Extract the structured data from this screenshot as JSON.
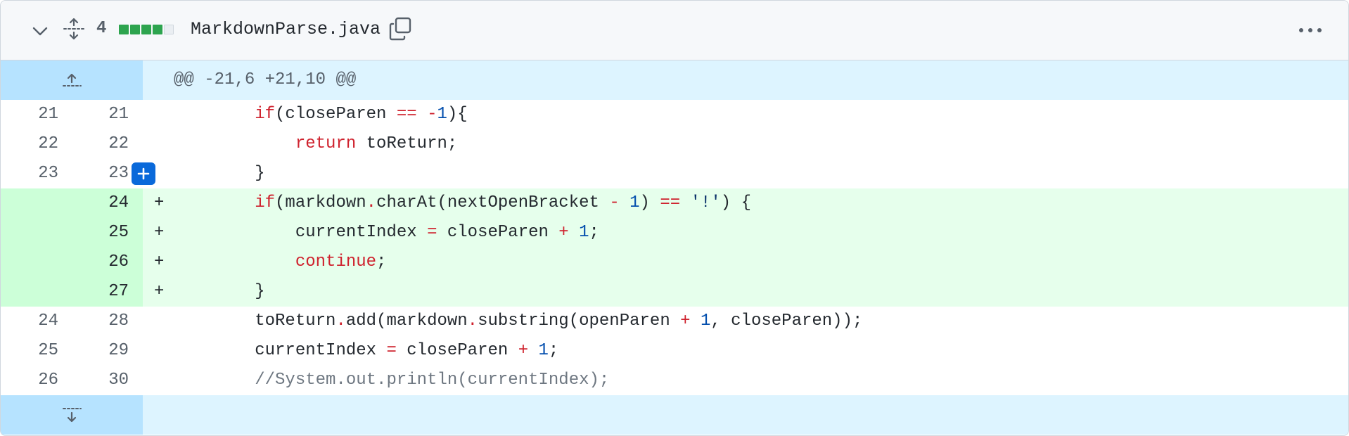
{
  "file": {
    "changes_count": "4",
    "diffstat_blocks": [
      "added",
      "added",
      "added",
      "added",
      "neutral"
    ],
    "filename": "MarkdownParse.java",
    "hunk_header": "@@ -21,6 +21,10 @@"
  },
  "lines": [
    {
      "old": "21",
      "new": "21",
      "type": "context",
      "marker": "",
      "tokens": [
        [
          "plain",
          "        "
        ],
        [
          "k",
          "if"
        ],
        [
          "plain",
          "(closeParen "
        ],
        [
          "k",
          "=="
        ],
        [
          "plain",
          " "
        ],
        [
          "k",
          "-"
        ],
        [
          "n",
          "1"
        ],
        [
          "plain",
          "){"
        ]
      ]
    },
    {
      "old": "22",
      "new": "22",
      "type": "context",
      "marker": "",
      "tokens": [
        [
          "plain",
          "            "
        ],
        [
          "k",
          "return"
        ],
        [
          "plain",
          " toReturn;"
        ]
      ]
    },
    {
      "old": "23",
      "new": "23",
      "type": "context",
      "marker": "",
      "tokens": [
        [
          "plain",
          "        }"
        ]
      ]
    },
    {
      "old": "",
      "new": "24",
      "type": "added",
      "marker": "+",
      "tokens": [
        [
          "plain",
          "        "
        ],
        [
          "k",
          "if"
        ],
        [
          "plain",
          "(markdown"
        ],
        [
          "k",
          "."
        ],
        [
          "plain",
          "charAt(nextOpenBracket "
        ],
        [
          "k",
          "-"
        ],
        [
          "plain",
          " "
        ],
        [
          "n",
          "1"
        ],
        [
          "plain",
          ") "
        ],
        [
          "k",
          "=="
        ],
        [
          "plain",
          " "
        ],
        [
          "s",
          "'!'"
        ],
        [
          "plain",
          ") {"
        ]
      ]
    },
    {
      "old": "",
      "new": "25",
      "type": "added",
      "marker": "+",
      "tokens": [
        [
          "plain",
          "            currentIndex "
        ],
        [
          "k",
          "="
        ],
        [
          "plain",
          " closeParen "
        ],
        [
          "k",
          "+"
        ],
        [
          "plain",
          " "
        ],
        [
          "n",
          "1"
        ],
        [
          "plain",
          ";"
        ]
      ]
    },
    {
      "old": "",
      "new": "26",
      "type": "added",
      "marker": "+",
      "tokens": [
        [
          "plain",
          "            "
        ],
        [
          "k",
          "continue"
        ],
        [
          "plain",
          ";"
        ]
      ]
    },
    {
      "old": "",
      "new": "27",
      "type": "added",
      "marker": "+",
      "tokens": [
        [
          "plain",
          "        }"
        ]
      ]
    },
    {
      "old": "24",
      "new": "28",
      "type": "context",
      "marker": "",
      "tokens": [
        [
          "plain",
          "        toReturn"
        ],
        [
          "k",
          "."
        ],
        [
          "plain",
          "add(markdown"
        ],
        [
          "k",
          "."
        ],
        [
          "plain",
          "substring(openParen "
        ],
        [
          "k",
          "+"
        ],
        [
          "plain",
          " "
        ],
        [
          "n",
          "1"
        ],
        [
          "plain",
          ", closeParen));"
        ]
      ]
    },
    {
      "old": "25",
      "new": "29",
      "type": "context",
      "marker": "",
      "tokens": [
        [
          "plain",
          "        currentIndex "
        ],
        [
          "k",
          "="
        ],
        [
          "plain",
          " closeParen "
        ],
        [
          "k",
          "+"
        ],
        [
          "plain",
          " "
        ],
        [
          "n",
          "1"
        ],
        [
          "plain",
          ";"
        ]
      ]
    },
    {
      "old": "26",
      "new": "30",
      "type": "context",
      "marker": "",
      "tokens": [
        [
          "plain",
          "        "
        ],
        [
          "c",
          "//System.out.println(currentIndex);"
        ]
      ]
    }
  ],
  "icons": {
    "collapse": "chevron-down-icon",
    "expand_all": "unfold-icon",
    "copy": "copy-icon",
    "more": "kebab-horizontal-icon",
    "expand_up": "expand-up-icon",
    "expand_down": "expand-down-icon",
    "add_comment": "plus-icon"
  },
  "colors": {
    "added_bg": "#e6ffec",
    "added_gutter": "#ccffd8",
    "hunk_bg": "#ddf4ff",
    "hunk_gutter": "#b6e3ff",
    "keyword": "#cf222e",
    "number": "#0550ae"
  }
}
